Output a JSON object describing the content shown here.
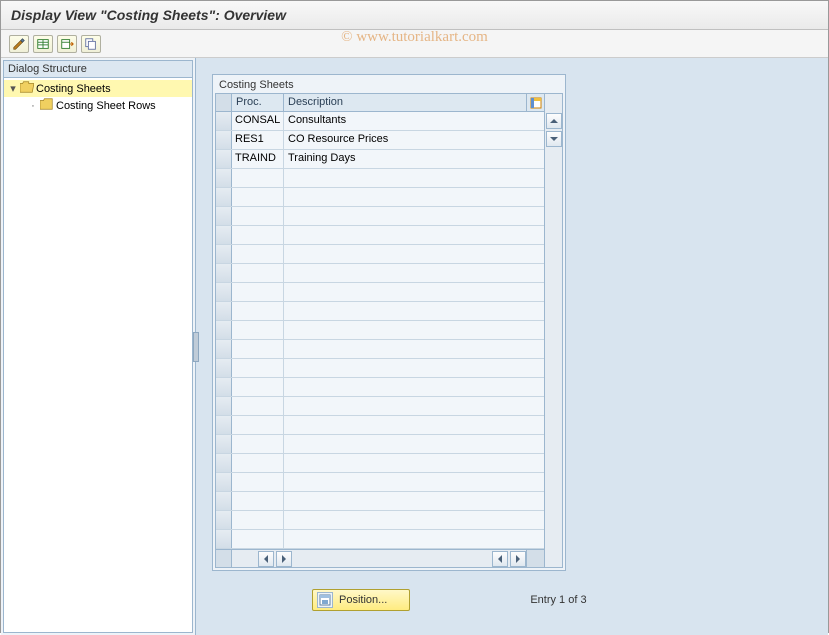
{
  "title": "Display View \"Costing Sheets\": Overview",
  "watermark": "© www.tutorialkart.com",
  "sidebar": {
    "title": "Dialog Structure",
    "items": [
      {
        "label": "Costing Sheets",
        "selected": true,
        "open": true
      },
      {
        "label": "Costing Sheet Rows",
        "selected": false,
        "open": false
      }
    ]
  },
  "panel": {
    "title": "Costing Sheets",
    "columns": {
      "proc": "Proc.",
      "desc": "Description"
    },
    "rows": [
      {
        "proc": "CONSAL",
        "desc": "Consultants"
      },
      {
        "proc": "RES1",
        "desc": "CO Resource Prices"
      },
      {
        "proc": "TRAIND",
        "desc": "Training Days"
      }
    ]
  },
  "footer": {
    "position_label": "Position...",
    "entry_text": "Entry 1 of 3"
  },
  "icons": {
    "tool_edit": "edit-icon",
    "tool_table1": "table-icon",
    "tool_table2": "table-export-icon",
    "tool_table3": "table-copy-icon"
  }
}
